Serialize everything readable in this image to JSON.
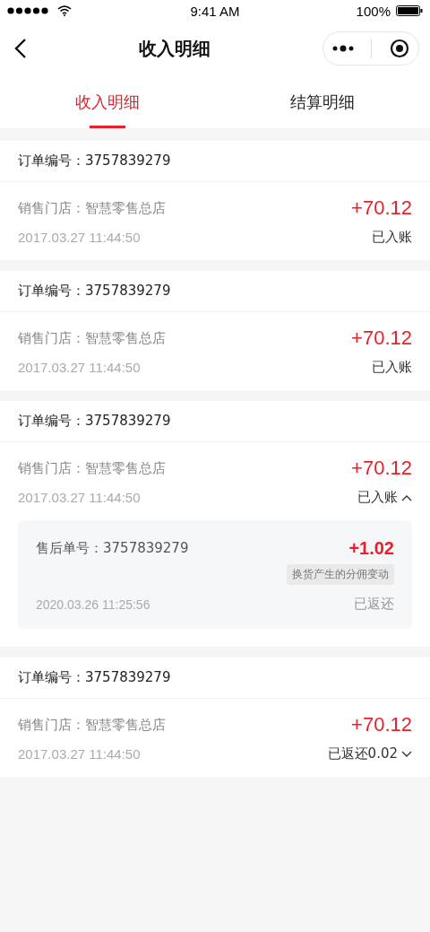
{
  "status_bar": {
    "time": "9:41 AM",
    "battery": "100%"
  },
  "nav": {
    "title": "收入明细"
  },
  "tabs": [
    {
      "label": "收入明细",
      "selected": true
    },
    {
      "label": "结算明细",
      "selected": false
    }
  ],
  "orders": [
    {
      "kind": "plain",
      "order_number": "订单编号：3757839279",
      "store": "销售门店：智慧零售总店",
      "amount": "+70.12",
      "time": "2017.03.27 11:44:50",
      "status": "已入账"
    },
    {
      "kind": "plain",
      "order_number": "订单编号：3757839279",
      "store": "销售门店：智慧零售总店",
      "amount": "+70.12",
      "time": "2017.03.27 11:44:50",
      "status": "已入账"
    },
    {
      "kind": "collapsible",
      "expanded": true,
      "order_number": "订单编号：3757839279",
      "store": "销售门店：智慧零售总店",
      "amount": "+70.12",
      "time": "2017.03.27 11:44:50",
      "status": "已入账",
      "after_sales": [
        {
          "number": "售后单号：3757839279",
          "amount": "+1.02",
          "tag": "换货产生的分佣变动",
          "time": "2020.03.26 11:25:56",
          "status": "已返还"
        }
      ]
    },
    {
      "kind": "collapsible",
      "expanded": false,
      "order_number": "订单编号：3757839279",
      "store": "销售门店：智慧零售总店",
      "amount": "+70.12",
      "time": "2017.03.27 11:44:50",
      "status": "已返还0.02"
    }
  ]
}
